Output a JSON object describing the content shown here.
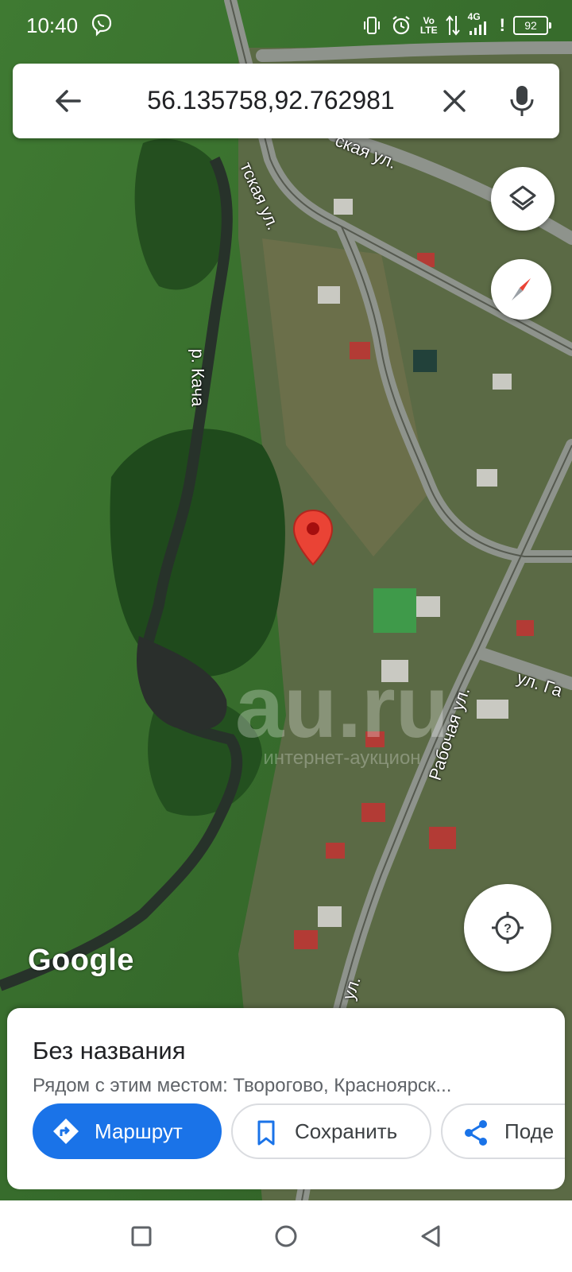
{
  "status_bar": {
    "time": "10:40",
    "network_label_top": "Vo",
    "network_label_bottom": "LTE",
    "signal_label": "4G",
    "battery": "92",
    "icons": [
      "viber-icon",
      "vibrate-icon",
      "alarm-icon",
      "data-arrows-icon",
      "signal-icon",
      "battery-icon"
    ]
  },
  "search": {
    "query": "56.135758,92.762981",
    "back_icon": "arrow-left-icon",
    "clear_icon": "close-icon",
    "mic_icon": "microphone-icon"
  },
  "map": {
    "labels": {
      "street_top": "ская ул.",
      "street_diag": "тская ул.",
      "river": "р. Кача",
      "rabochaya": "Рабочая ул.",
      "gag": "ул. Га",
      "bottom_street": "ул."
    },
    "google_logo": "Google",
    "watermark_main": "au.ru",
    "watermark_sub": "интернет-аукцион",
    "pin_color": "#ea4335"
  },
  "controls": {
    "layers_icon": "layers-icon",
    "compass_icon": "compass-icon",
    "my_location_icon": "my-location-icon"
  },
  "place_sheet": {
    "title": "Без названия",
    "subtitle": "Рядом с этим местом: Творогово, Красноярск...",
    "route_label": "Маршрут",
    "save_label": "Сохранить",
    "share_label": "Поде",
    "accent": "#1a73e8"
  },
  "nav_bar": {
    "icons": [
      "recents-square-icon",
      "home-circle-icon",
      "back-triangle-icon"
    ]
  }
}
